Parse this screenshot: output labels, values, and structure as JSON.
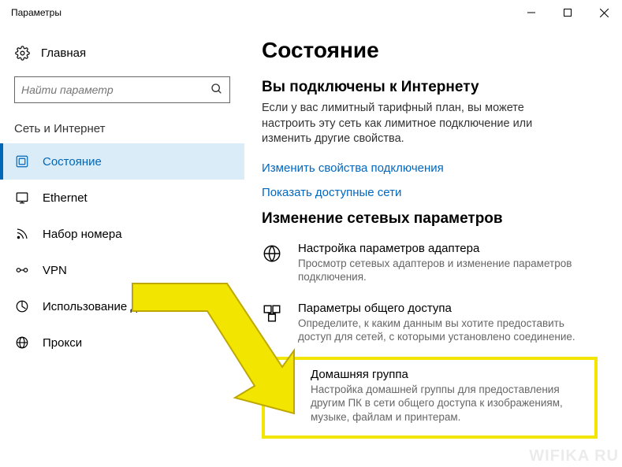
{
  "window": {
    "title": "Параметры"
  },
  "sidebar": {
    "home": "Главная",
    "search_placeholder": "Найти параметр",
    "category": "Сеть и Интернет",
    "items": [
      {
        "label": "Состояние"
      },
      {
        "label": "Ethernet"
      },
      {
        "label": "Набор номера"
      },
      {
        "label": "VPN"
      },
      {
        "label": "Использование д…"
      },
      {
        "label": "Прокси"
      }
    ]
  },
  "main": {
    "page_title": "Состояние",
    "connected_heading": "Вы подключены к Интернету",
    "connected_body": "Если у вас лимитный тарифный план, вы можете настроить эту сеть как лимитное подключение или изменить другие свойства.",
    "link_properties": "Изменить свойства подключения",
    "link_networks": "Показать доступные сети",
    "change_heading": "Изменение сетевых параметров",
    "options": [
      {
        "title": "Настройка параметров адаптера",
        "desc": "Просмотр сетевых адаптеров и изменение параметров подключения."
      },
      {
        "title": "Параметры общего доступа",
        "desc": "Определите, к каким данным вы хотите предоставить доступ для сетей, с которыми установлено соединение."
      },
      {
        "title": "Домашняя группа",
        "desc": "Настройка домашней группы для предоставления другим ПК в сети общего доступа к изображениям, музыке, файлам и принтерам."
      }
    ]
  },
  "watermark": "WIFIKA RU"
}
